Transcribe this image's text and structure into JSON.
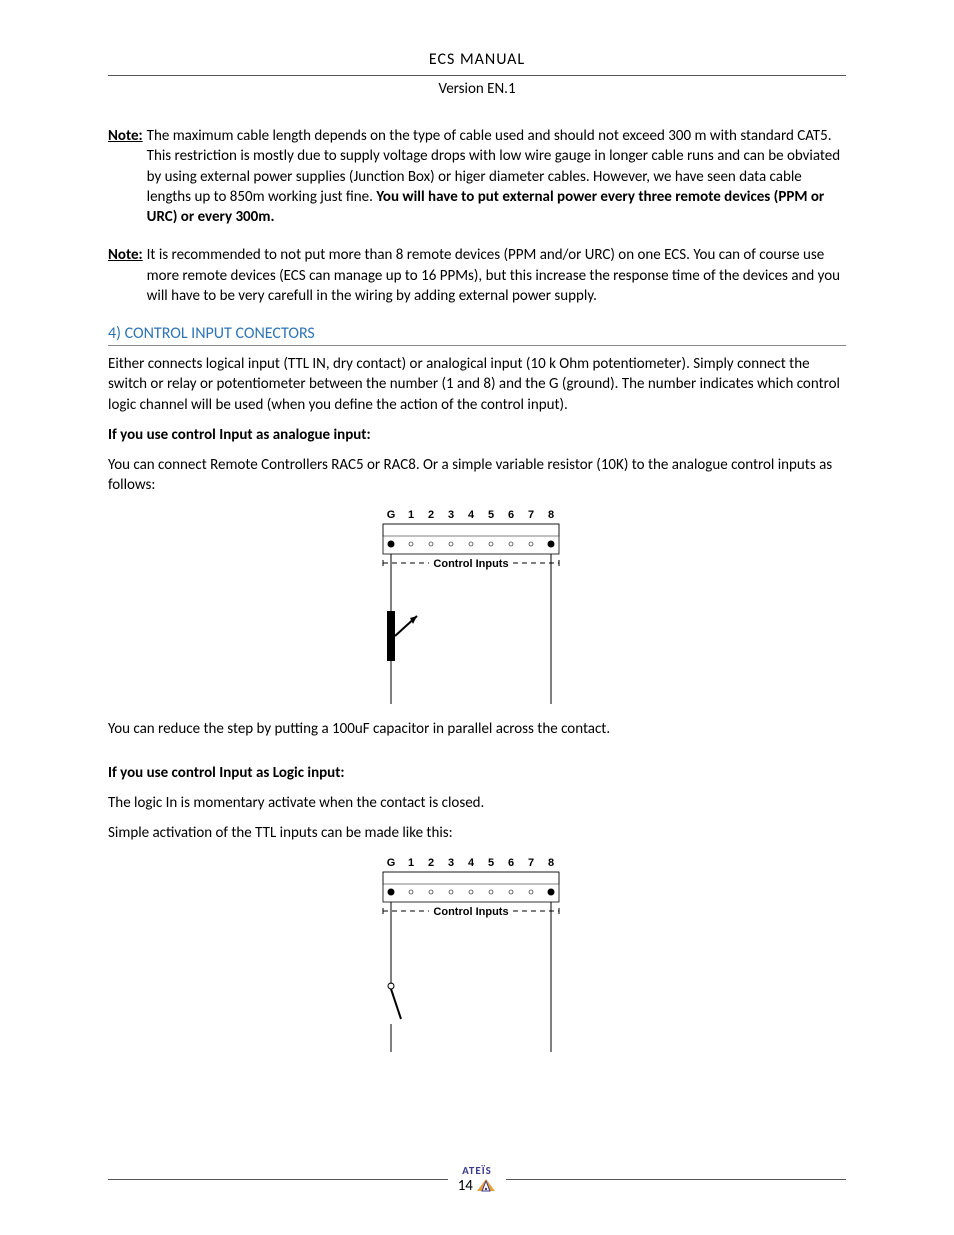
{
  "header": {
    "title": "ECS  MANUAL",
    "version": "Version EN.1"
  },
  "notes": [
    {
      "label": "Note:",
      "p1": "The maximum cable length depends on the type of cable used and should not exceed 300 m with standard CAT5.",
      "p2": "This restriction is mostly due to supply voltage drops with low wire gauge in longer cable runs and can be obviated by using external power supplies (Junction Box) or higer diameter cables. However, we have seen data cable lengths up to 850m working just fine. ",
      "p2_bold": "You will have to put external power every three remote devices (PPM or URC) or every 300m."
    },
    {
      "label": "Note:",
      "p1": "It is recommended to not put more than 8 remote devices (PPM and/or URC) on one ECS. You can of course use more remote devices (ECS can manage up to 16 PPMs), but this increase the response time of the devices and you will have to be very carefull in the wiring by adding external power supply."
    }
  ],
  "section": {
    "heading": "4) CONTROL INPUT CONECTORS",
    "intro": "Either connects logical input (TTL IN, dry contact) or analogical input (10 k Ohm potentiometer). Simply connect the switch or relay or potentiometer between the number (1 and 8) and the G (ground). The number indicates which control logic channel will be used (when you define the action of the control input).",
    "analogue": {
      "heading": "If you use control Input as analogue input:",
      "text": "You can connect Remote Controllers RAC5 or RAC8. Or a simple variable resistor (10K) to the analogue control inputs as follows:",
      "diagram_labels": [
        "G",
        "1",
        "2",
        "3",
        "4",
        "5",
        "6",
        "7",
        "8"
      ],
      "diagram_caption": "Control Inputs",
      "after": "You can reduce the step by putting a 100uF capacitor in parallel across the contact."
    },
    "logic": {
      "heading": "If you use control Input as Logic input:",
      "text1": "The logic In is momentary activate when the contact is closed.",
      "text2": "Simple activation of the TTL inputs can be made like this:",
      "diagram_labels": [
        "G",
        "1",
        "2",
        "3",
        "4",
        "5",
        "6",
        "7",
        "8"
      ],
      "diagram_caption": "Control Inputs"
    }
  },
  "footer": {
    "logo_text": "ATEÏS",
    "page_number": "14"
  }
}
